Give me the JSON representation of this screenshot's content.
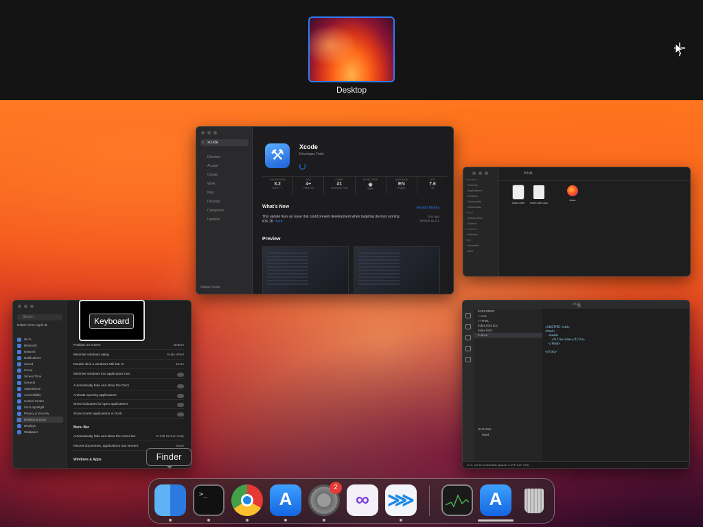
{
  "spaces": {
    "desktop_label": "Desktop"
  },
  "appstore": {
    "search_value": "xcode",
    "sidebar": [
      "Discover",
      "Arcade",
      "Create",
      "Work",
      "Play",
      "Develop",
      "Categories",
      "Updates"
    ],
    "user": "Rafael Vieira",
    "app_name": "Xcode",
    "app_category": "Developer Tools",
    "stats": [
      {
        "head": "3,5K RATINGS",
        "value": "3.2",
        "sub": "★★★☆☆"
      },
      {
        "head": "AGE",
        "value": "4+",
        "sub": "Years Old"
      },
      {
        "head": "CHART",
        "value": "#1",
        "sub": "Developer Tools"
      },
      {
        "head": "DEVELOPER",
        "value": "",
        "sub": "Apple"
      },
      {
        "head": "LANGUAGE",
        "value": "EN",
        "sub": "English"
      },
      {
        "head": "SIZE",
        "value": "7.6",
        "sub": "GB"
      }
    ],
    "whats_new": "What’s New",
    "version_history": "Version History",
    "update_text": "This update fixes an issue that could prevent development when targeting devices running iOS 18.",
    "more": "more",
    "meta_line1": "1mo ago",
    "meta_line2": "Version 16.2.1",
    "preview": "Preview"
  },
  "finder": {
    "title": "HTML",
    "sidebar": [
      "Favorites",
      "Recents",
      "Applications",
      "Desktop",
      "Documents",
      "Downloads",
      "iCloud",
      "iCloud Drive",
      "Shared",
      "Locations",
      "Network",
      "Tags",
      "Vermelho",
      "Azul"
    ],
    "files": [
      "index.html",
      "index.html.doc",
      "ulcss"
    ]
  },
  "vscode": {
    "title": "ulcss",
    "explorer": [
      "EXPLORER",
      "> LCS",
      "  > HTML",
      "    index.html.doc",
      "    index.html",
      "  # ulcss"
    ],
    "outline": "OUTLINE",
    "outline_item": "head",
    "timeline": "TIMELINE",
    "code": "<!DOCTYPE html>\n<html>\n  <head>\n    <title>index</title>\n  </head>\n\n</html>",
    "status": "Ln 2, Col 16 (4 selected)   Spaces: 4   UTF-8   LF   CSS"
  },
  "settings": {
    "search": "Search",
    "profile": "Rafael Vieira Apple ID",
    "sidebar": [
      "Wi-Fi",
      "Bluetooth",
      "Network",
      "Notifications",
      "Sound",
      "Focus",
      "Screen Time",
      "General",
      "Appearance",
      "Accessibility",
      "Control Centre",
      "Siri & Spotlight",
      "Privacy & Security",
      "Desktop & Dock",
      "Displays",
      "Wallpaper"
    ],
    "rows": [
      {
        "label": "Position on screen",
        "value": "Bottom"
      },
      {
        "label": "Minimise windows using",
        "value": "Scale effect"
      },
      {
        "label": "Double-click a window’s title bar to",
        "value": "Zoom"
      },
      {
        "label": "Minimise windows into application icon",
        "value": ""
      },
      {
        "label": "Automatically hide and show the Dock",
        "value": ""
      },
      {
        "label": "Animate opening applications",
        "value": ""
      },
      {
        "label": "Show indicators for open applications",
        "value": ""
      },
      {
        "label": "Show recent applications in Dock",
        "value": ""
      }
    ],
    "group_menubar": "Menu Bar",
    "menubar_rows": [
      {
        "label": "Automatically hide and show the menu bar",
        "value": "In Full Screen Only"
      },
      {
        "label": "Recent documents, applications and servers",
        "value": "None"
      }
    ],
    "group_windows": "Windows & Apps"
  },
  "labels": {
    "keyboard": "Keyboard",
    "finder_tip": "Finder"
  },
  "dock": {
    "items": [
      "Finder",
      "Terminal",
      "Google Chrome",
      "App Store",
      "System Settings",
      "Visual Studio",
      "Visual Studio Code",
      "Activity Monitor",
      "App Store Preview",
      "Trash"
    ],
    "settings_badge": "2"
  },
  "colors": {
    "accent": "#2e7cf6",
    "badge": "#e53935"
  }
}
